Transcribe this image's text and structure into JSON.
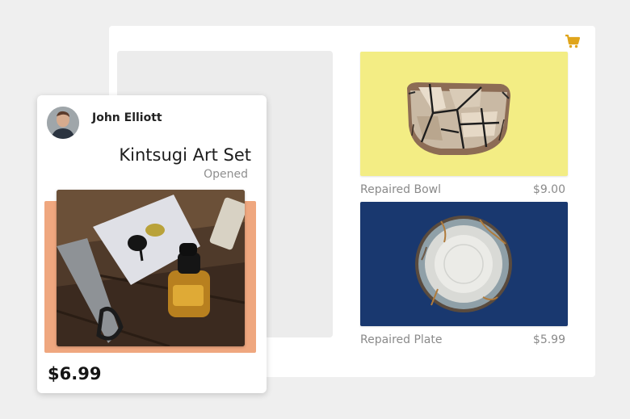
{
  "cart": {
    "icon": "cart-icon",
    "color": "#e0a51b"
  },
  "featured": {
    "author": "John Elliott",
    "title": "Kintsugi Art Set",
    "status": "Opened",
    "price": "$6.99",
    "accent_color": "#efa77f"
  },
  "products": [
    {
      "name": "Repaired Bowl",
      "price": "$9.00",
      "background": "#f3ed84"
    },
    {
      "name": "Repaired Plate",
      "price": "$5.99",
      "background": "#19386f"
    }
  ]
}
